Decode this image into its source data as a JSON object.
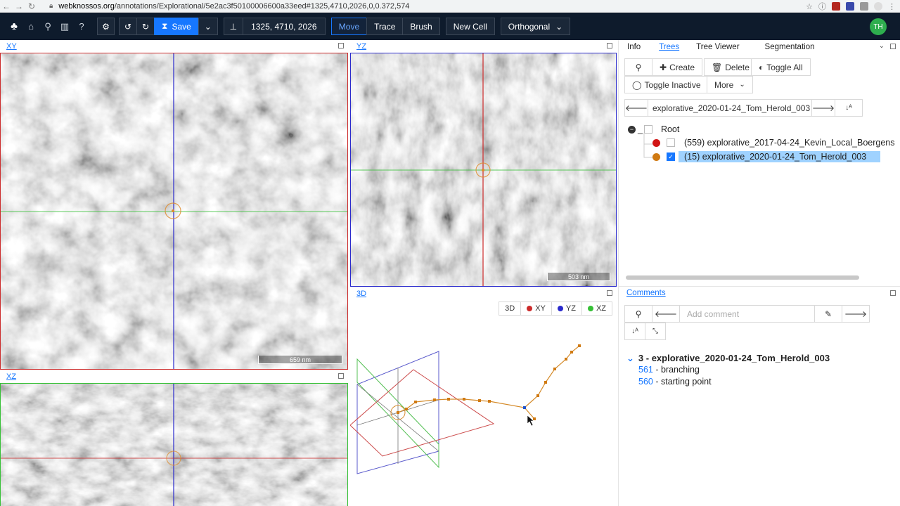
{
  "browser": {
    "url_domain": "webknossos.org",
    "url_path": "/annotations/Explorational/5e2ac3f50100006600a33eed#1325,4710,2026,0,0.372,574"
  },
  "toolbar": {
    "undo_icon": "undo-icon",
    "redo_icon": "redo-icon",
    "save_label": "Save",
    "position_value": "1325, 4710, 2026",
    "modes": [
      "Move",
      "Trace",
      "Brush"
    ],
    "active_mode": "Move",
    "new_cell_label": "New Cell",
    "view_mode": "Orthogonal",
    "user_initials": "TH",
    "accent": "#1677ff"
  },
  "viewports": {
    "xy": {
      "label": "XY",
      "scale": "659 nm",
      "border": "#cc2a2a"
    },
    "yz": {
      "label": "YZ",
      "scale": "503 nm",
      "border": "#2a2acc"
    },
    "xz": {
      "label": "XZ",
      "border": "#35c035"
    },
    "td": {
      "label": "3D",
      "buttons": [
        "3D",
        "XY",
        "YZ",
        "XZ"
      ]
    }
  },
  "panel": {
    "tabs": [
      "Info",
      "Trees",
      "Tree Viewer",
      "Segmentation"
    ],
    "active_tab": "Trees",
    "create_label": "Create",
    "delete_label": "Delete",
    "toggle_all_label": "Toggle All",
    "toggle_inactive_label": "Toggle Inactive",
    "more_label": "More",
    "active_tree_name": "explorative_2020-01-24_Tom_Herold_003",
    "root_label": "Root",
    "trees": [
      {
        "label": "(559) explorative_2017-04-24_Kevin_Local_Boergens",
        "color": "#d11414",
        "checked": false
      },
      {
        "label": "(15) explorative_2020-01-24_Tom_Herold_003",
        "color": "#d07a12",
        "checked": true
      }
    ]
  },
  "comments": {
    "title": "Comments",
    "placeholder": "Add comment",
    "group_title": "3 - explorative_2020-01-24_Tom_Herold_003",
    "items": [
      {
        "id": "561",
        "text": " - branching"
      },
      {
        "id": "560",
        "text": " - starting point"
      }
    ]
  }
}
